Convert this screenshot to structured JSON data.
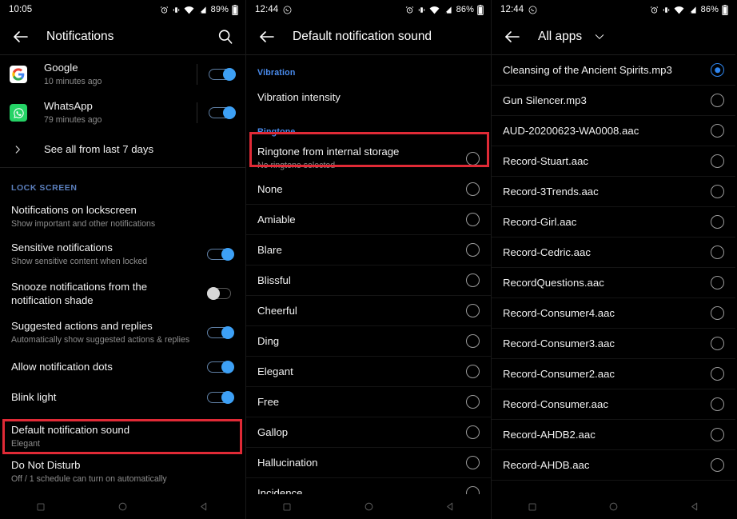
{
  "panels": [
    {
      "status": {
        "time": "10:05",
        "battery": "89%",
        "icons": [
          "alarm-icon",
          "vibrate-icon",
          "wifi-icon",
          "signal-icon",
          "battery-icon"
        ]
      },
      "toolbar": {
        "title": "Notifications",
        "back": "back-arrow",
        "search": "search-icon"
      },
      "notifications": [
        {
          "app": "Google",
          "time": "10 minutes ago",
          "toggle": "on"
        },
        {
          "app": "WhatsApp",
          "time": "79 minutes ago",
          "toggle": "on"
        }
      ],
      "see_all": "See all from last 7 days",
      "lock_section": "LOCK SCREEN",
      "settings": [
        {
          "title": "Notifications on lockscreen",
          "sub": "Show important and other notifications",
          "toggle": null
        },
        {
          "title": "Sensitive notifications",
          "sub": "Show sensitive content when locked",
          "toggle": "on"
        },
        {
          "title": "Snooze notifications from the notification shade",
          "sub": "",
          "toggle": "off"
        },
        {
          "title": "Suggested actions and replies",
          "sub": "Automatically show suggested actions & replies",
          "toggle": "on"
        },
        {
          "title": "Allow notification dots",
          "sub": "",
          "toggle": "on"
        },
        {
          "title": "Blink light",
          "sub": "",
          "toggle": "on"
        },
        {
          "title": "Default notification sound",
          "sub": "Elegant",
          "toggle": null,
          "highlight": true
        },
        {
          "title": "Do Not Disturb",
          "sub": "Off / 1 schedule can turn on automatically",
          "toggle": null
        }
      ],
      "nav": [
        "recents-square-icon",
        "home-circle-icon",
        "back-triangle-icon"
      ]
    },
    {
      "status": {
        "time": "12:44",
        "battery": "86%",
        "icons": [
          "whatsapp-notif-icon",
          "alarm-icon",
          "vibrate-icon",
          "wifi-icon",
          "signal-icon",
          "battery-icon"
        ]
      },
      "toolbar": {
        "title": "Default notification sound",
        "back": "back-arrow"
      },
      "vibration_section": "Vibration",
      "vibration_item": "Vibration intensity",
      "ringtone_section": "Ringtone",
      "internal_storage": {
        "title": "Ringtone from internal storage",
        "sub": "No ringtone selected",
        "selected": false,
        "highlight": true
      },
      "ringtones": [
        {
          "label": "None",
          "selected": false
        },
        {
          "label": "Amiable",
          "selected": false
        },
        {
          "label": "Blare",
          "selected": false
        },
        {
          "label": "Blissful",
          "selected": false
        },
        {
          "label": "Cheerful",
          "selected": false
        },
        {
          "label": "Ding",
          "selected": false
        },
        {
          "label": "Elegant",
          "selected": false
        },
        {
          "label": "Free",
          "selected": false
        },
        {
          "label": "Gallop",
          "selected": false
        },
        {
          "label": "Hallucination",
          "selected": false
        },
        {
          "label": "Incidence",
          "selected": false
        }
      ],
      "nav": [
        "recents-square-icon",
        "home-circle-icon",
        "back-triangle-icon"
      ]
    },
    {
      "status": {
        "time": "12:44",
        "battery": "86%",
        "icons": [
          "whatsapp-notif-icon",
          "alarm-icon",
          "vibrate-icon",
          "wifi-icon",
          "signal-icon",
          "battery-icon"
        ]
      },
      "toolbar": {
        "title": "All apps",
        "back": "back-arrow",
        "caret": "chevron-down-icon"
      },
      "files": [
        {
          "label": "Cleansing of the Ancient Spirits.mp3",
          "selected": true
        },
        {
          "label": "Gun Silencer.mp3",
          "selected": false
        },
        {
          "label": "AUD-20200623-WA0008.aac",
          "selected": false
        },
        {
          "label": "Record-Stuart.aac",
          "selected": false
        },
        {
          "label": "Record-3Trends.aac",
          "selected": false
        },
        {
          "label": "Record-Girl.aac",
          "selected": false
        },
        {
          "label": "Record-Cedric.aac",
          "selected": false
        },
        {
          "label": "RecordQuestions.aac",
          "selected": false
        },
        {
          "label": "Record-Consumer4.aac",
          "selected": false
        },
        {
          "label": "Record-Consumer3.aac",
          "selected": false
        },
        {
          "label": "Record-Consumer2.aac",
          "selected": false
        },
        {
          "label": "Record-Consumer.aac",
          "selected": false
        },
        {
          "label": "Record-AHDB2.aac",
          "selected": false
        },
        {
          "label": "Record-AHDB.aac",
          "selected": false
        }
      ],
      "nav": [
        "recents-square-icon",
        "home-circle-icon",
        "back-triangle-icon"
      ]
    }
  ],
  "colors": {
    "accent_blue": "#3da0f5",
    "section_blue": "#4a8df0",
    "lock_section_blue": "#5b7fbd",
    "highlight_red": "#e02a36",
    "background": "#000000"
  }
}
